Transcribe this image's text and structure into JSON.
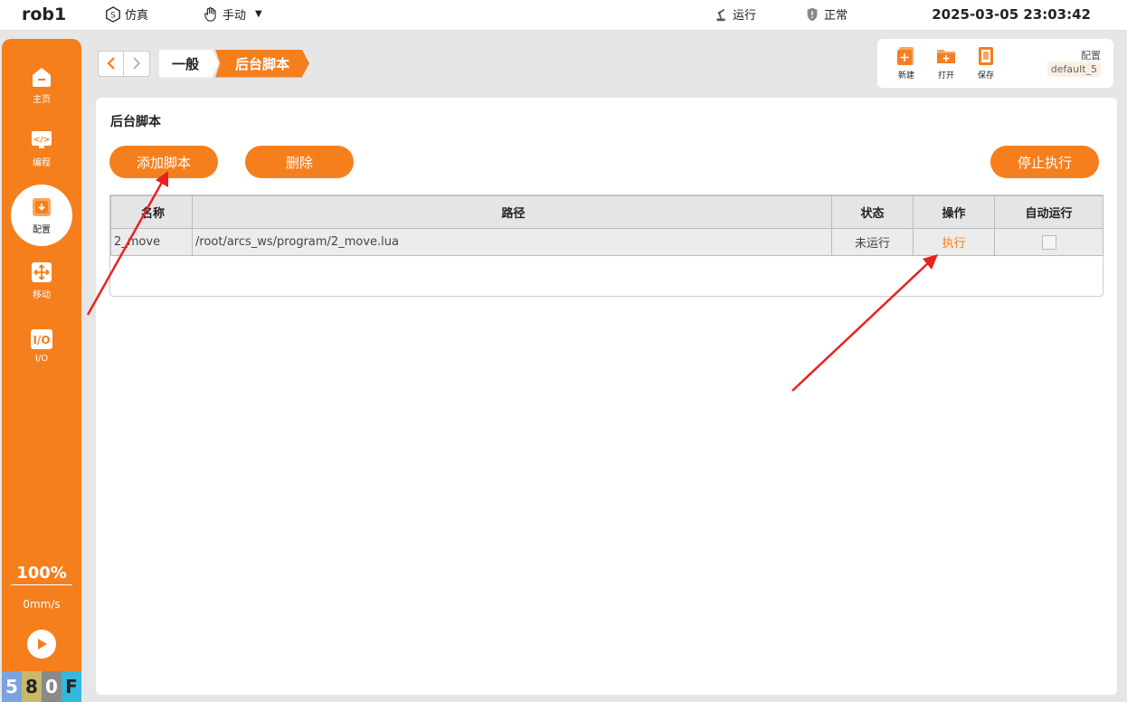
{
  "topbar": {
    "app_name": "rob1",
    "mode_sim": "仿真",
    "mode_manual": "手动",
    "run_status": "运行",
    "health_status": "正常",
    "datetime": "2025-03-05 23:03:42"
  },
  "sidebar": {
    "items": [
      {
        "label": "主页",
        "icon": "home-icon"
      },
      {
        "label": "编程",
        "icon": "code-icon"
      },
      {
        "label": "配置",
        "icon": "config-icon"
      },
      {
        "label": "移动",
        "icon": "move-icon"
      },
      {
        "label": "I/O",
        "icon": "io-icon"
      }
    ],
    "speed_percent": "100%",
    "speed_mms": "0mm/s",
    "code_chars": [
      "5",
      "8",
      "0",
      "F"
    ],
    "code_colors": [
      "#7aa3e0",
      "#c9b76a",
      "#8a8a8a",
      "#35b8e0"
    ]
  },
  "breadcrumb": {
    "items": [
      "一般",
      "后台脚本"
    ]
  },
  "toolbar": {
    "new_label": "新建",
    "open_label": "打开",
    "save_label": "保存",
    "config_label": "配置",
    "config_value": "default_5"
  },
  "panel": {
    "title": "后台脚本",
    "add_button": "添加脚本",
    "delete_button": "删除",
    "stop_button": "停止执行",
    "columns": [
      "名称",
      "路径",
      "状态",
      "操作",
      "自动运行"
    ],
    "rows": [
      {
        "name": "2_move",
        "path": "/root/arcs_ws/program/2_move.lua",
        "status": "未运行",
        "action": "执行"
      }
    ]
  },
  "colors": {
    "accent": "#f57f1d",
    "annotation": "#e8231e"
  }
}
